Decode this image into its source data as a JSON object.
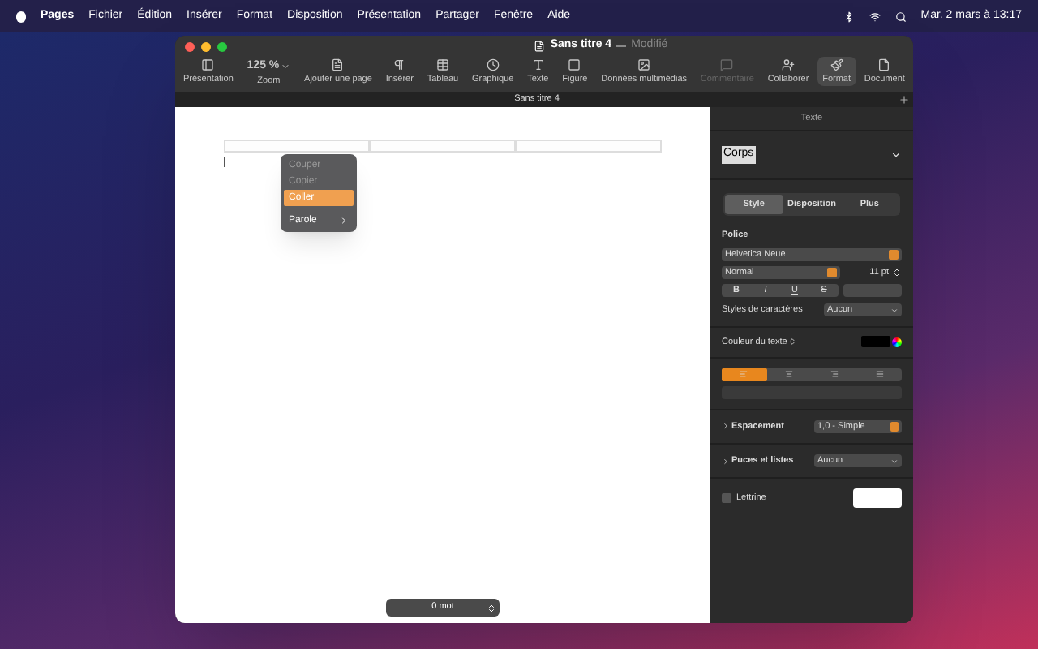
{
  "menubar": {
    "app": "Pages",
    "items": [
      "Fichier",
      "Édition",
      "Insérer",
      "Format",
      "Disposition",
      "Présentation",
      "Partager",
      "Fenêtre",
      "Aide"
    ],
    "clock": "Mar. 2 mars à 13:17"
  },
  "window": {
    "title": "Sans titre 4",
    "status": "Modifié",
    "tab": "Sans titre 4"
  },
  "toolbar": [
    {
      "kind": "presentation",
      "label": "Présentation",
      "disabled": false,
      "selected": false
    },
    {
      "kind": "zoom",
      "label": "Zoom",
      "value": "125 %",
      "disabled": false,
      "selected": false
    },
    {
      "kind": "addpage",
      "label": "Ajouter une page",
      "disabled": false,
      "selected": false
    },
    {
      "kind": "insert",
      "label": "Insérer",
      "disabled": false,
      "selected": false
    },
    {
      "kind": "table",
      "label": "Tableau",
      "disabled": false,
      "selected": false
    },
    {
      "kind": "chart",
      "label": "Graphique",
      "disabled": false,
      "selected": false
    },
    {
      "kind": "text",
      "label": "Texte",
      "disabled": false,
      "selected": false
    },
    {
      "kind": "shape",
      "label": "Figure",
      "disabled": false,
      "selected": false
    },
    {
      "kind": "media",
      "label": "Données multimédias",
      "disabled": false,
      "selected": false
    },
    {
      "kind": "comment",
      "label": "Commentaire",
      "disabled": true,
      "selected": false
    },
    {
      "kind": "collab",
      "label": "Collaborer",
      "disabled": false,
      "selected": false
    },
    {
      "kind": "format",
      "label": "Format",
      "disabled": false,
      "selected": true
    },
    {
      "kind": "document",
      "label": "Document",
      "disabled": false,
      "selected": false
    }
  ],
  "context_menu": [
    {
      "kind": "item",
      "label": "Couper",
      "disabled": true,
      "selected": false
    },
    {
      "kind": "item",
      "label": "Copier",
      "disabled": true,
      "selected": false
    },
    {
      "kind": "item",
      "label": "Coller",
      "disabled": false,
      "selected": true
    },
    {
      "kind": "submenu",
      "label": "Parole",
      "disabled": false,
      "selected": false
    }
  ],
  "word_count": "0 mot",
  "sidebar": {
    "header": "Texte",
    "paragraph_style": "Corps",
    "tabs": [
      {
        "label": "Style",
        "selected": true
      },
      {
        "label": "Disposition",
        "selected": false
      },
      {
        "label": "Plus",
        "selected": false
      }
    ],
    "font_section": "Police",
    "font": "Helvetica Neue",
    "weight": "Normal",
    "size": "11 pt",
    "format_buttons": [
      "B",
      "I",
      "U",
      "S"
    ],
    "char_styles_label": "Styles de caractères",
    "char_styles_value": "Aucun",
    "text_color_label": "Couleur du texte",
    "alignment": [
      {
        "selected": true
      },
      {
        "selected": false
      },
      {
        "selected": false
      },
      {
        "selected": false
      }
    ],
    "spacing_label": "Espacement",
    "spacing_value": "1,0 - Simple",
    "bullets_label": "Puces et listes",
    "bullets_value": "Aucun",
    "dropcap_label": "Lettrine",
    "dropcap_checked": false
  }
}
